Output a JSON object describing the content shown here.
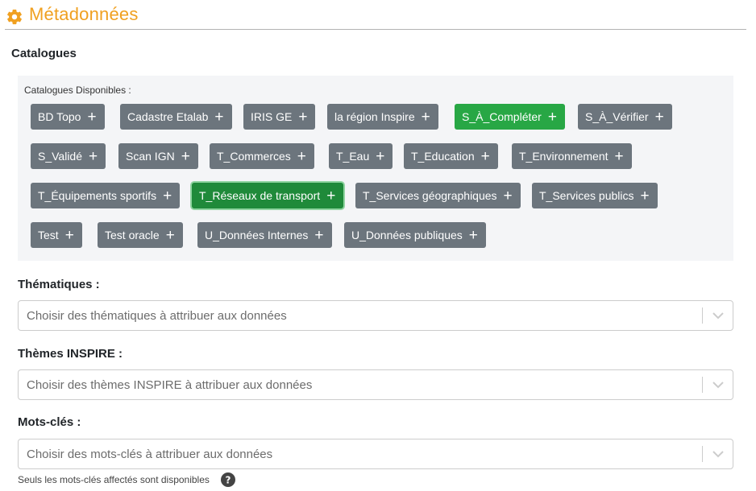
{
  "header": {
    "title": "Métadonnées",
    "icon": "gear-icon",
    "accent_color": "#f0a020"
  },
  "catalogues": {
    "section_title": "Catalogues",
    "available_label": "Catalogues Disponibles :",
    "tags": [
      {
        "label": "BD Topo",
        "state": "default"
      },
      {
        "label": "Cadastre Etalab",
        "state": "default"
      },
      {
        "label": "IRIS GE",
        "state": "default"
      },
      {
        "label": "la région Inspire",
        "state": "default"
      },
      {
        "label": "S_À_Compléter",
        "state": "active"
      },
      {
        "label": "S_À_Vérifier",
        "state": "default"
      },
      {
        "label": "S_Validé",
        "state": "default"
      },
      {
        "label": "Scan IGN",
        "state": "default"
      },
      {
        "label": "T_Commerces",
        "state": "default"
      },
      {
        "label": "T_Eau",
        "state": "default"
      },
      {
        "label": "T_Education",
        "state": "default"
      },
      {
        "label": "T_Environnement",
        "state": "default"
      },
      {
        "label": "T_Équipements sportifs",
        "state": "default"
      },
      {
        "label": "T_Réseaux de transport",
        "state": "selected"
      },
      {
        "label": "T_Services géographiques",
        "state": "default"
      },
      {
        "label": "T_Services publics",
        "state": "default"
      },
      {
        "label": "Test",
        "state": "default"
      },
      {
        "label": "Test oracle",
        "state": "default"
      },
      {
        "label": "U_Données Internes",
        "state": "default"
      },
      {
        "label": "U_Données publiques",
        "state": "default"
      }
    ],
    "add_symbol": "+",
    "colors": {
      "default": "#6c757d",
      "active": "#28a745",
      "selected": "#1f8a3a"
    }
  },
  "thematiques": {
    "label": "Thématiques :",
    "placeholder": "Choisir des thématiques à attribuer aux données"
  },
  "themes_inspire": {
    "label": "Thèmes INSPIRE :",
    "placeholder": "Choisir des thèmes INSPIRE à attribuer aux données"
  },
  "mots_cles": {
    "label": "Mots-clés :",
    "placeholder": "Choisir des mots-clés à attribuer aux données",
    "help_text": "Seuls les mots-clés affectés sont disponibles",
    "help_icon": "question-circle-icon"
  }
}
